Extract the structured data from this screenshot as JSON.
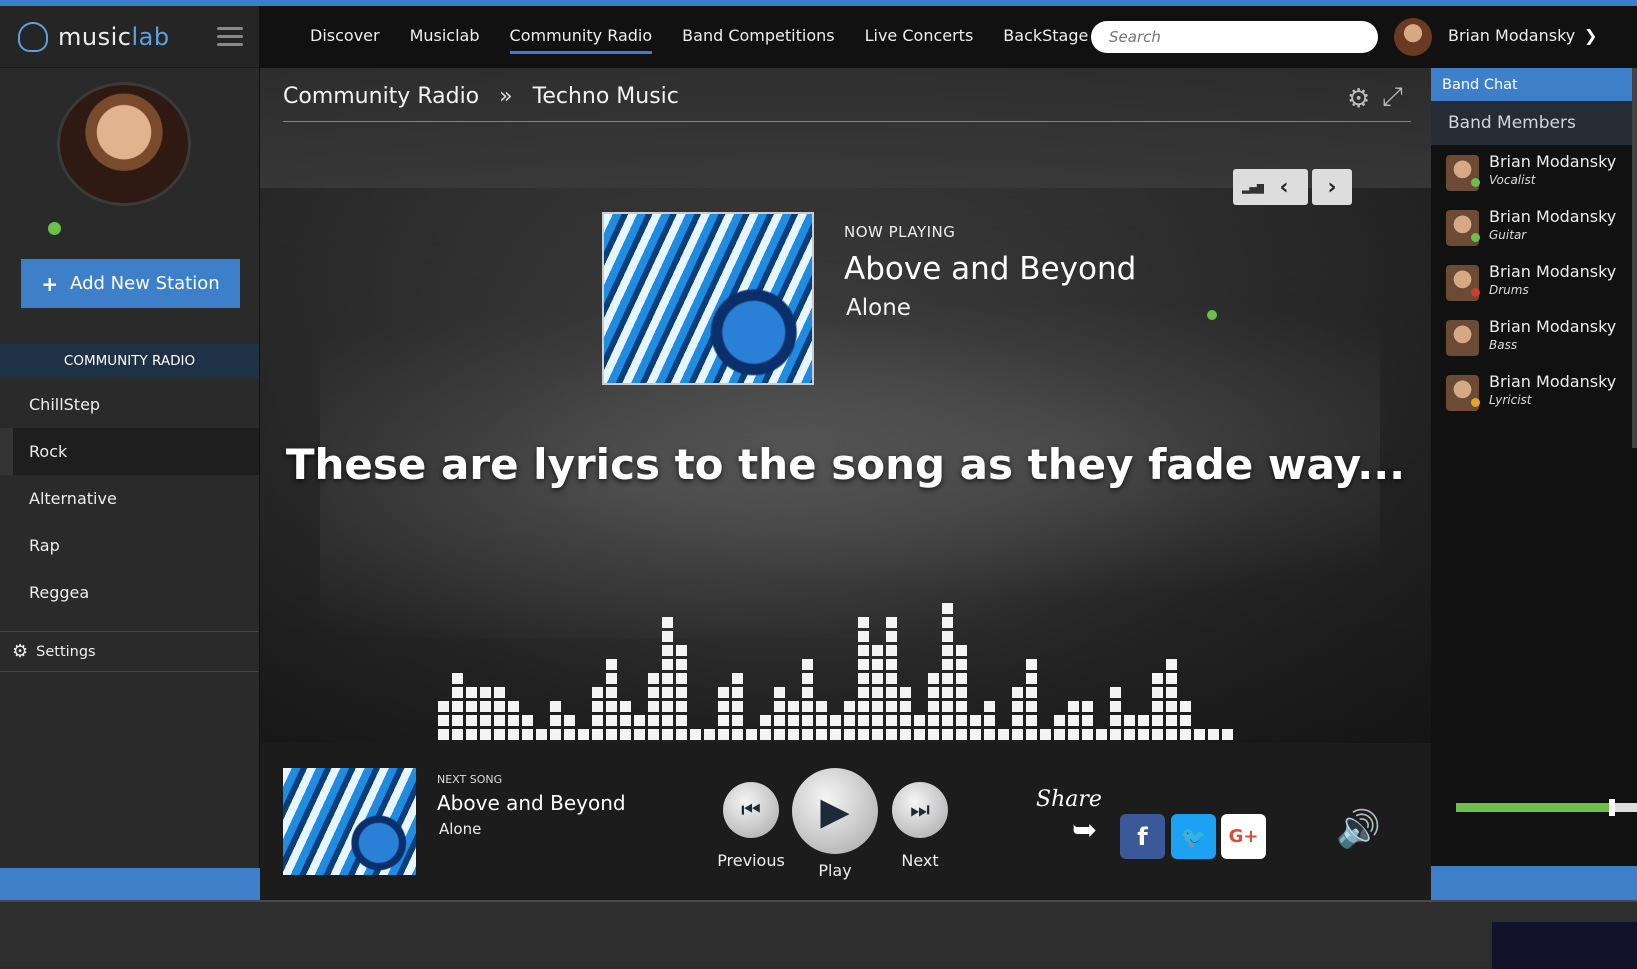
{
  "app": {
    "logo_prefix": "music",
    "logo_suffix": "lab"
  },
  "nav": {
    "items": [
      {
        "label": "Discover"
      },
      {
        "label": "Musiclab"
      },
      {
        "label": "Community Radio",
        "active": true
      },
      {
        "label": "Band Competitions"
      },
      {
        "label": "Live Concerts"
      },
      {
        "label": "BackStage"
      }
    ],
    "search_placeholder": "Search",
    "user_name": "Brian Modansky"
  },
  "sidebar": {
    "add_station_label": "Add New Station",
    "section_title": "COMMUNITY RADIO",
    "stations": [
      {
        "label": "ChillStep"
      },
      {
        "label": "Rock",
        "active": true
      },
      {
        "label": "Alternative"
      },
      {
        "label": "Rap"
      },
      {
        "label": "Reggea"
      }
    ],
    "settings_label": "Settings"
  },
  "main": {
    "breadcrumb": [
      "Community Radio",
      "Techno Music"
    ],
    "now_playing_label": "NOW PLAYING",
    "artist": "Above and Beyond",
    "song": "Alone",
    "lyrics": "These are lyrics to the song as they fade way..."
  },
  "player": {
    "next_label": "NEXT SONG",
    "next_artist": "Above and Beyond",
    "next_song": "Alone",
    "previous_label": "Previous",
    "play_label": "Play",
    "next_button_label": "Next",
    "share_label": "Share",
    "volume_level": 0.86
  },
  "band": {
    "chat_label": "Band Chat",
    "members_label": "Band Members",
    "members": [
      {
        "name": "Brian Modansky",
        "role": "Vocalist",
        "status_color": "#6cc04a"
      },
      {
        "name": "Brian Modansky",
        "role": "Guitar",
        "status_color": "#6cc04a"
      },
      {
        "name": "Brian Modansky",
        "role": "Drums",
        "status_color": "#d23b2f"
      },
      {
        "name": "Brian Modansky",
        "role": "Bass",
        "status_color": ""
      },
      {
        "name": "Brian Modansky",
        "role": "Lyricist",
        "status_color": "#e6a52a"
      }
    ]
  },
  "colors": {
    "accent": "#3d7fc9",
    "online": "#6cc04a"
  },
  "equalizer_levels": [
    3,
    5,
    4,
    4,
    4,
    3,
    2,
    1,
    3,
    2,
    1,
    4,
    6,
    3,
    2,
    5,
    9,
    7,
    1,
    1,
    4,
    5,
    1,
    2,
    4,
    3,
    6,
    3,
    2,
    3,
    9,
    7,
    9,
    4,
    2,
    5,
    10,
    7,
    2,
    3,
    1,
    4,
    6,
    1,
    2,
    3,
    3,
    1,
    4,
    2,
    2,
    5,
    6,
    3,
    1,
    1,
    1
  ]
}
